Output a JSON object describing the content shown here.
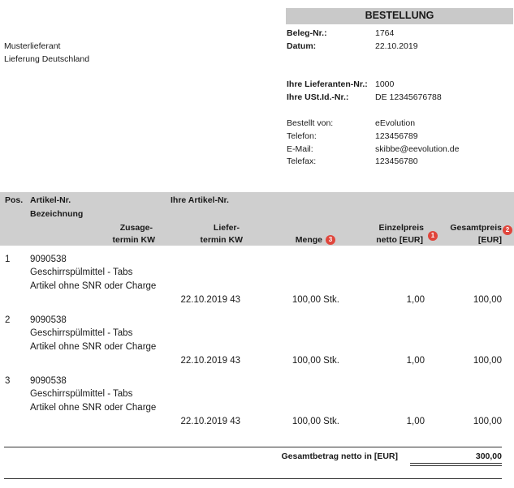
{
  "header": {
    "title": "BESTELLUNG",
    "beleg_label": "Beleg-Nr.:",
    "beleg_value": "1764",
    "datum_label": "Datum:",
    "datum_value": "22.10.2019",
    "lieferanten_label": "Ihre Lieferanten-Nr.:",
    "lieferanten_value": "1000",
    "ustid_label": "Ihre USt.Id.-Nr.:",
    "ustid_value": "DE 12345676788",
    "bestellt_label": "Bestellt von:",
    "bestellt_value": "eEvolution",
    "telefon_label": "Telefon:",
    "telefon_value": "123456789",
    "email_label": "E-Mail:",
    "email_value": "skibbe@eevolution.de",
    "telefax_label": "Telefax:",
    "telefax_value": "123456780"
  },
  "supplier": {
    "name": "Musterlieferant",
    "line2": "Lieferung Deutschland"
  },
  "table_header": {
    "pos": "Pos.",
    "artikel_nr": "Artikel-Nr.",
    "ihre_artikel_nr": "Ihre Artikel-Nr.",
    "bezeichnung": "Bezeichnung",
    "zusage_1": "Zusage-",
    "zusage_2": "termin KW",
    "liefer_1": "Liefer-",
    "liefer_2": "termin KW",
    "menge": "Menge",
    "einzel_1": "Einzelpreis",
    "einzel_2": "netto [EUR]",
    "gesamt_1": "Gesamtpreis",
    "gesamt_2": "[EUR]"
  },
  "badges": {
    "menge": "3",
    "einzel": "1",
    "gesamt": "2"
  },
  "rows": [
    {
      "pos": "1",
      "artikel": "9090538",
      "bez1": "Geschirrspülmittel - Tabs",
      "bez2": "Artikel ohne SNR oder Charge",
      "liefertermin": "22.10.2019 43",
      "menge": "100,00 Stk.",
      "einzelpreis": "1,00",
      "gesamtpreis": "100,00"
    },
    {
      "pos": "2",
      "artikel": "9090538",
      "bez1": "Geschirrspülmittel - Tabs",
      "bez2": "Artikel ohne SNR oder Charge",
      "liefertermin": "22.10.2019 43",
      "menge": "100,00 Stk.",
      "einzelpreis": "1,00",
      "gesamtpreis": "100,00"
    },
    {
      "pos": "3",
      "artikel": "9090538",
      "bez1": "Geschirrspülmittel - Tabs",
      "bez2": "Artikel ohne SNR oder Charge",
      "liefertermin": "22.10.2019 43",
      "menge": "100,00 Stk.",
      "einzelpreis": "1,00",
      "gesamtpreis": "100,00"
    }
  ],
  "total": {
    "label": "Gesamtbetrag netto in [EUR]",
    "value": "300,00"
  },
  "colors": {
    "header_band": "#cfcfcf",
    "title_box": "#c9c9c9",
    "badge": "#e0463c"
  }
}
